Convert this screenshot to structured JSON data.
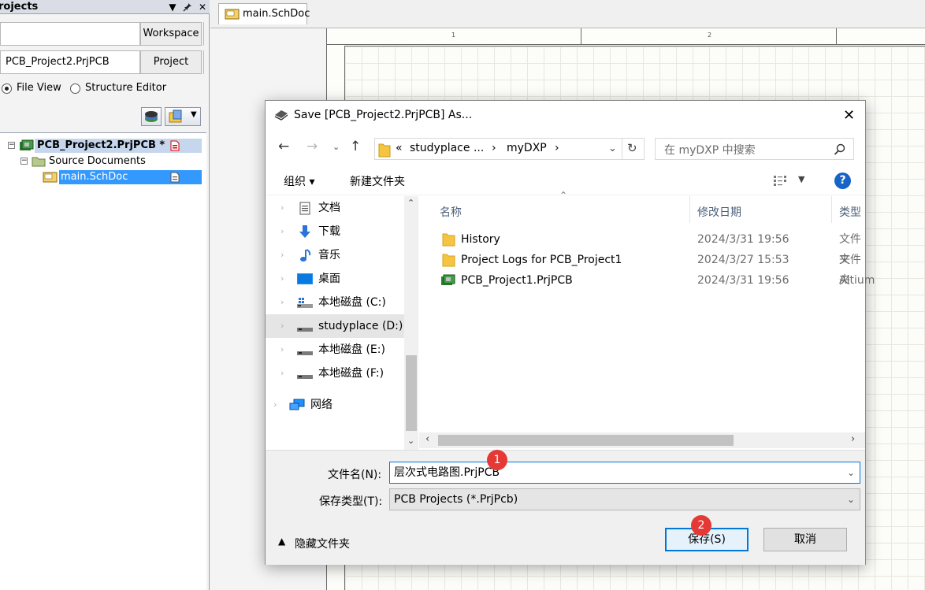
{
  "projects_panel": {
    "title": "rojects",
    "workspace_field_value": "",
    "workspace_button": "Workspace",
    "project_field_value": "PCB_Project2.PrjPCB",
    "project_button": "Project",
    "radio_file_view": "File View",
    "radio_structure_editor": "Structure Editor",
    "tree": {
      "project": "PCB_Project2.PrjPCB *",
      "folder": "Source Documents",
      "document": "main.SchDoc"
    }
  },
  "editor": {
    "tab_label": "main.SchDoc",
    "ruler_marks": [
      "1",
      "2"
    ]
  },
  "dialog": {
    "title": "Save [PCB_Project2.PrjPCB] As...",
    "address": {
      "prefix": "«",
      "segment1": "studyplace ...",
      "separator": "›",
      "segment2": "myDXP",
      "separator2": "›"
    },
    "search_placeholder": "在 myDXP 中搜索",
    "toolbar": {
      "organize": "组织 ▾",
      "new_folder": "新建文件夹"
    },
    "nav_items": [
      {
        "label": "文档",
        "icon": "document-icon"
      },
      {
        "label": "下载",
        "icon": "download-icon"
      },
      {
        "label": "音乐",
        "icon": "music-icon"
      },
      {
        "label": "桌面",
        "icon": "desktop-icon"
      },
      {
        "label": "本地磁盘 (C:)",
        "icon": "drive-c-icon"
      },
      {
        "label": "studyplace (D:)",
        "icon": "drive-icon"
      },
      {
        "label": "本地磁盘 (E:)",
        "icon": "drive-icon"
      },
      {
        "label": "本地磁盘 (F:)",
        "icon": "drive-icon"
      },
      {
        "label": "网络",
        "icon": "network-icon"
      }
    ],
    "columns": {
      "name": "名称",
      "modified": "修改日期",
      "type": "类型"
    },
    "files": [
      {
        "name": "History",
        "modified": "2024/3/31 19:56",
        "type": "文件夹",
        "icon": "folder-icon"
      },
      {
        "name": "Project Logs for PCB_Project1",
        "modified": "2024/3/27 15:53",
        "type": "文件夹",
        "icon": "folder-icon"
      },
      {
        "name": "PCB_Project1.PrjPCB",
        "modified": "2024/3/31 19:56",
        "type": "Altium",
        "icon": "pcb-project-icon"
      }
    ],
    "filename_label": "文件名(N):",
    "filename_value": "层次式电路图.PrjPCB",
    "filetype_label": "保存类型(T):",
    "filetype_value": "PCB Projects (*.PrjPcb)",
    "hide_folders": "隐藏文件夹",
    "save_button": "保存(S)",
    "cancel_button": "取消",
    "badges": [
      "1",
      "2"
    ]
  },
  "colors": {
    "accent": "#0078d7",
    "badge": "#e53935",
    "tree_selection": "#3399ff",
    "folder": "#f5c542"
  }
}
